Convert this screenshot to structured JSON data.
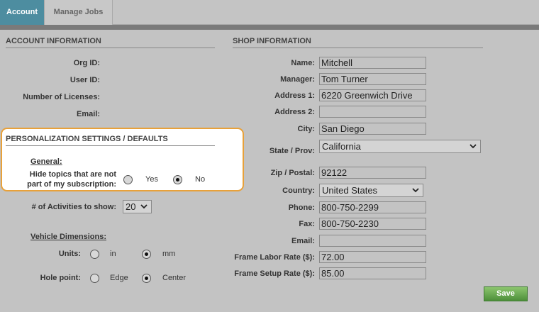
{
  "tabs": [
    {
      "label": "Account",
      "active": true
    },
    {
      "label": "Manage Jobs",
      "active": false
    }
  ],
  "account_info": {
    "title": "ACCOUNT INFORMATION",
    "labels": {
      "org_id": "Org ID:",
      "user_id": "User ID:",
      "licenses": "Number of Licenses:",
      "email": "Email:"
    }
  },
  "personalization": {
    "title": "PERSONALIZATION SETTINGS / DEFAULTS",
    "general_label": "General:",
    "hide_topics_line1": "Hide topics that are not",
    "hide_topics_line2": "part of my subscription:",
    "yes_label": "Yes",
    "no_label": "No",
    "selected": "No"
  },
  "activities": {
    "label": "# of Activities to show:",
    "value": "20"
  },
  "vehicle_dimensions": {
    "title": "Vehicle Dimensions:",
    "units_label": "Units:",
    "units_in": "in",
    "units_mm": "mm",
    "units_selected": "mm",
    "hole_label": "Hole point:",
    "hole_edge": "Edge",
    "hole_center": "Center",
    "hole_selected": "Center"
  },
  "shop_info": {
    "title": "SHOP INFORMATION",
    "name_label": "Name:",
    "name": "Mitchell",
    "manager_label": "Manager:",
    "manager": "Tom Turner",
    "address1_label": "Address 1:",
    "address1": "6220 Greenwich Drive",
    "address2_label": "Address 2:",
    "address2": "",
    "city_label": "City:",
    "city": "San Diego",
    "state_label": "State / Prov:",
    "state": "California",
    "zip_label": "Zip / Postal:",
    "zip": "92122",
    "country_label": "Country:",
    "country": "United States",
    "phone_label": "Phone:",
    "phone": "800-750-2299",
    "fax_label": "Fax:",
    "fax": "800-750-2230",
    "email_label": "Email:",
    "email": "",
    "labor_label": "Frame Labor Rate ($):",
    "labor": "72.00",
    "setup_label": "Frame Setup Rate ($):",
    "setup": "85.00"
  },
  "save_label": "Save",
  "colors": {
    "tab_active": "#4d8da0",
    "highlight_border": "#e8a13a",
    "save_button": "#5a9c44"
  }
}
